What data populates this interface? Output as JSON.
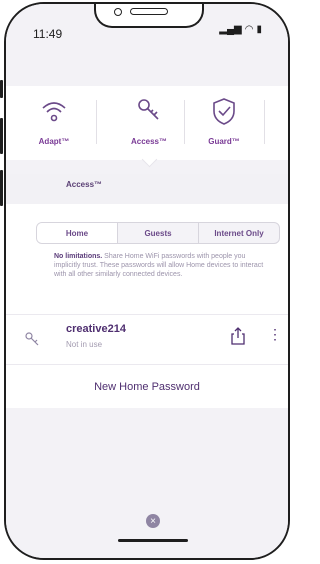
{
  "status": {
    "time": "11:49"
  },
  "tabs": [
    {
      "label": "Adapt™",
      "icon": "wifi-icon"
    },
    {
      "label": "Access™",
      "icon": "key-icon"
    },
    {
      "label": "Guard™",
      "icon": "shield-check-icon"
    }
  ],
  "section": {
    "title": "Access™"
  },
  "segments": [
    "Home",
    "Guests",
    "Internet Only"
  ],
  "description": {
    "bold": "No limitations.",
    "text": " Share Home WiFi passwords with people you implicitly trust. These passwords will allow Home devices to interact with all other similarly connected devices."
  },
  "network": {
    "name": "creative214",
    "status": "Not in use"
  },
  "actions": {
    "new_password": "New Home Password",
    "close": "×",
    "more": "⋮"
  },
  "colors": {
    "accent": "#7a3b96",
    "text_primary": "#4f2f70",
    "background": "#f3f2f6"
  }
}
